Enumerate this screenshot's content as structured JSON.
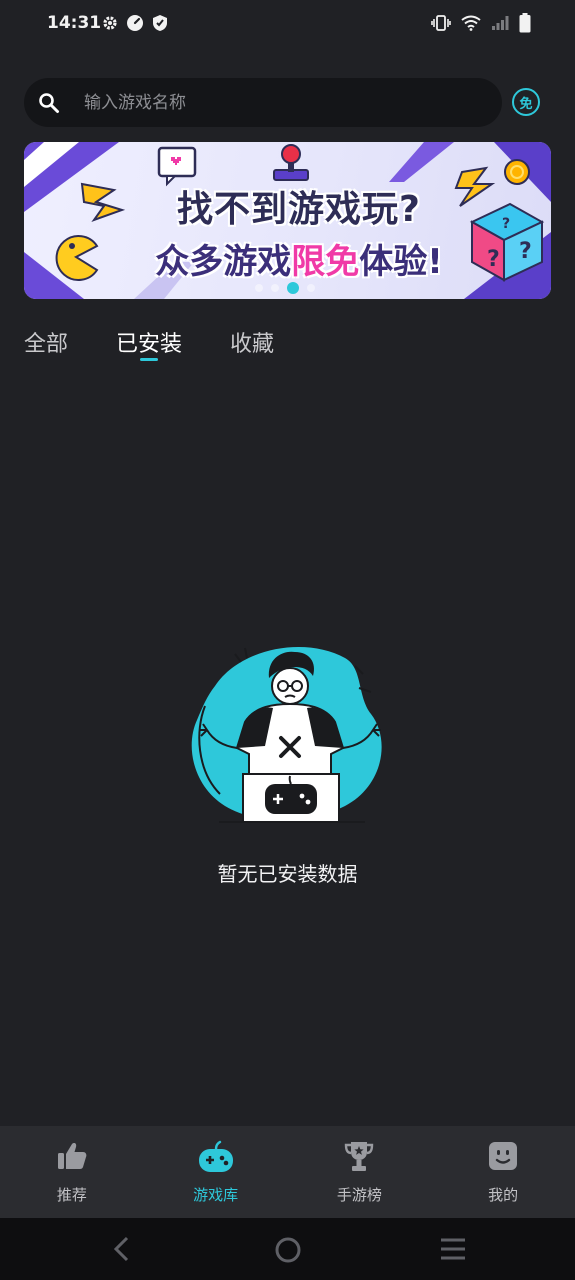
{
  "status_bar": {
    "time": "14:31",
    "left_icons": [
      "gear-icon",
      "speedometer-icon",
      "shield-icon"
    ],
    "right_icons": [
      "vibrate-icon",
      "wifi-icon",
      "signal-icon",
      "battery-icon"
    ]
  },
  "search": {
    "placeholder": "输入游戏名称",
    "value": "",
    "free_badge": "免"
  },
  "banner": {
    "line1": "找不到游戏玩?",
    "line2_prefix": "众多游戏",
    "line2_highlight": "限免",
    "line2_suffix": "体验!",
    "page_count": 4,
    "active_page": 3
  },
  "tabs": [
    {
      "label": "全部",
      "active": false
    },
    {
      "label": "已安装",
      "active": true
    },
    {
      "label": "收藏",
      "active": false
    }
  ],
  "empty_state": {
    "message": "暂无已安装数据"
  },
  "bottom_nav": [
    {
      "label": "推荐",
      "icon": "thumbs-up-icon",
      "active": false
    },
    {
      "label": "游戏库",
      "icon": "gamepad-icon",
      "active": true
    },
    {
      "label": "手游榜",
      "icon": "trophy-icon",
      "active": false
    },
    {
      "label": "我的",
      "icon": "smiley-face-icon",
      "active": false
    }
  ],
  "system_nav": [
    "back-icon",
    "home-icon",
    "recents-icon"
  ],
  "colors": {
    "background": "#202125",
    "accent": "#2ec8da",
    "search_bg": "#141518",
    "nav_bg": "#2b2c30",
    "highlight_pink": "#f03aa7"
  }
}
